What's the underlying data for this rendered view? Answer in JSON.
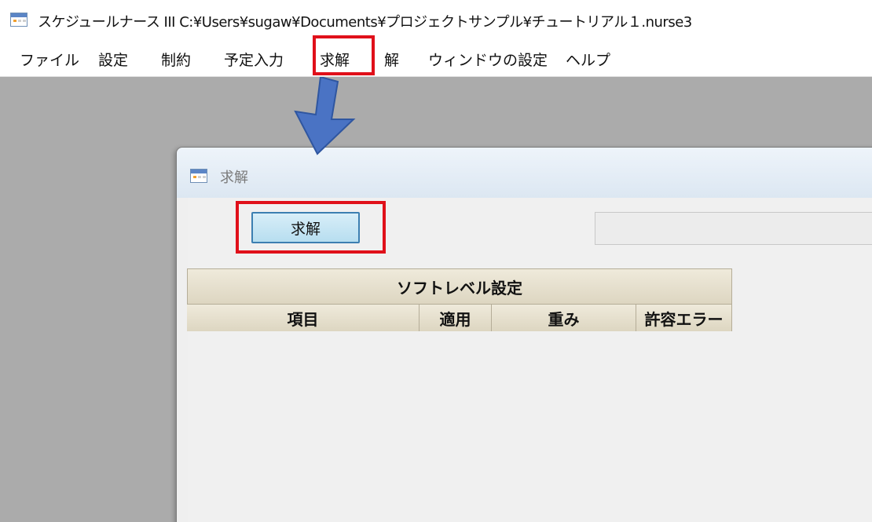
{
  "window": {
    "title": "スケジュールナース III    C:¥Users¥sugaw¥Documents¥プロジェクトサンプル¥チュートリアル１.nurse3"
  },
  "menu": {
    "items": [
      "ファイル",
      "設定",
      "制約",
      "予定入力",
      "求解",
      "解",
      "ウィンドウの設定",
      "ヘルプ"
    ],
    "highlighted": "求解"
  },
  "dialog": {
    "title": "求解",
    "solve_button": "求解",
    "status_text": "",
    "grid": {
      "header": "ソフトレベル設定",
      "columns": [
        "項目",
        "適用",
        "重み",
        "許容エラー"
      ]
    }
  },
  "annotation": {
    "highlight_color": "#e0101a",
    "arrow_color": "#4a73c4"
  }
}
